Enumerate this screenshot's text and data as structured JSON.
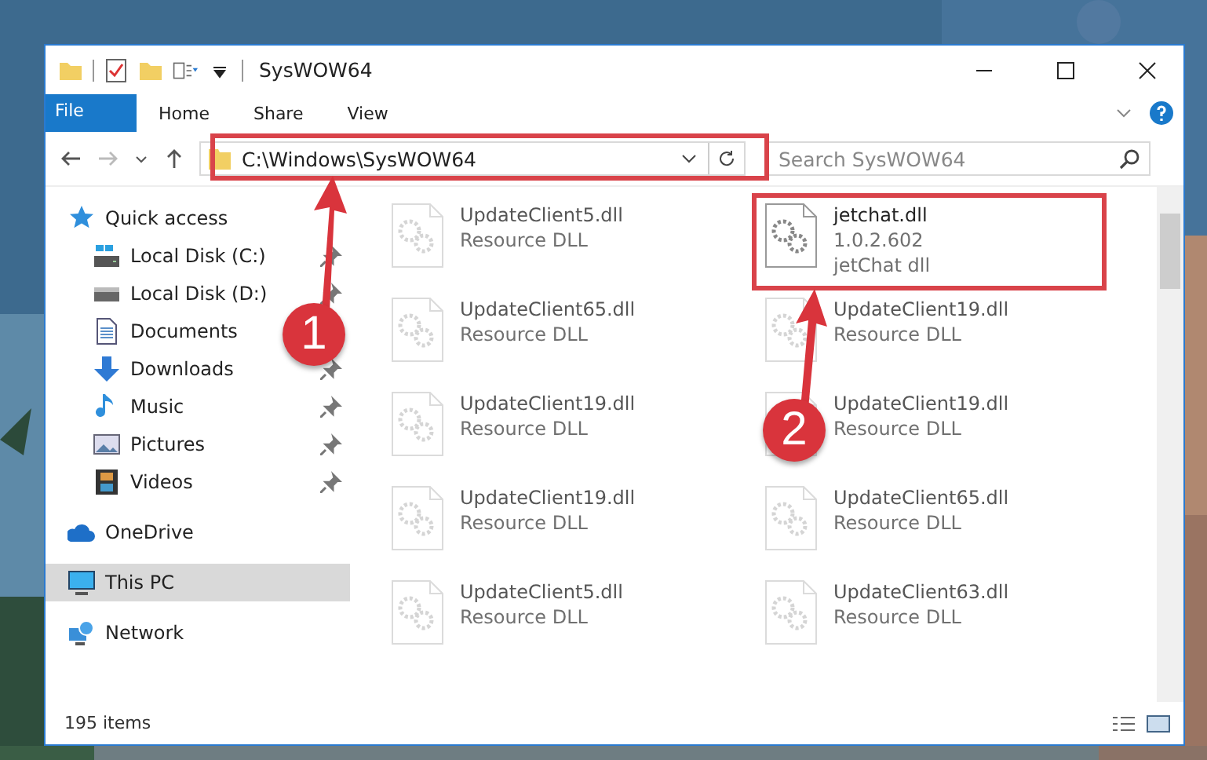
{
  "window": {
    "title": "SysWOW64"
  },
  "ribbon": {
    "tabs": [
      {
        "label": "File",
        "kind": "file",
        "selected": false
      },
      {
        "label": "Home",
        "kind": "tab",
        "selected": false
      },
      {
        "label": "Share",
        "kind": "tab",
        "selected": false
      },
      {
        "label": "View",
        "kind": "tab",
        "selected": false
      }
    ]
  },
  "address_bar": {
    "path": "C:\\Windows\\SysWOW64"
  },
  "search": {
    "placeholder": "Search SysWOW64"
  },
  "sidebar": {
    "items": [
      {
        "label": "Quick access",
        "selected": false,
        "children": [
          {
            "label": "Local Disk (C:)",
            "pinned": true,
            "selected": false
          },
          {
            "label": "Local Disk (D:)",
            "pinned": true,
            "selected": false
          },
          {
            "label": "Documents",
            "selected": false
          },
          {
            "label": "Downloads",
            "pinned": true,
            "selected": false
          },
          {
            "label": "Music",
            "pinned": true,
            "selected": false
          },
          {
            "label": "Pictures",
            "pinned": true,
            "selected": false
          },
          {
            "label": "Videos",
            "pinned": true,
            "selected": false
          }
        ]
      },
      {
        "label": "OneDrive",
        "selected": false
      },
      {
        "label": "This PC",
        "selected": true
      },
      {
        "label": "Network",
        "selected": false
      }
    ]
  },
  "files": [
    {
      "name": "UpdateClient5.dll",
      "details": [
        "Resource DLL"
      ],
      "highlighted": false
    },
    {
      "name": "jetchat.dll",
      "details": [
        "1.0.2.602",
        "jetChat dll"
      ],
      "highlighted": true
    },
    {
      "name": "UpdateClient65.dll",
      "details": [
        "Resource DLL"
      ],
      "highlighted": false
    },
    {
      "name": "UpdateClient19.dll",
      "details": [
        "Resource DLL"
      ],
      "highlighted": false
    },
    {
      "name": "UpdateClient19.dll",
      "details": [
        "Resource DLL"
      ],
      "highlighted": false
    },
    {
      "name": "UpdateClient19.dll",
      "details": [
        "Resource DLL"
      ],
      "highlighted": false
    },
    {
      "name": "UpdateClient19.dll",
      "details": [
        "Resource DLL"
      ],
      "highlighted": false
    },
    {
      "name": "UpdateClient65.dll",
      "details": [
        "Resource DLL"
      ],
      "highlighted": false
    },
    {
      "name": "UpdateClient5.dll",
      "details": [
        "Resource DLL"
      ],
      "highlighted": false
    },
    {
      "name": "UpdateClient63.dll",
      "details": [
        "Resource DLL"
      ],
      "highlighted": false
    }
  ],
  "status_bar": {
    "item_count": "195 items"
  },
  "callouts": [
    {
      "label": "1"
    },
    {
      "label": "2"
    }
  ]
}
